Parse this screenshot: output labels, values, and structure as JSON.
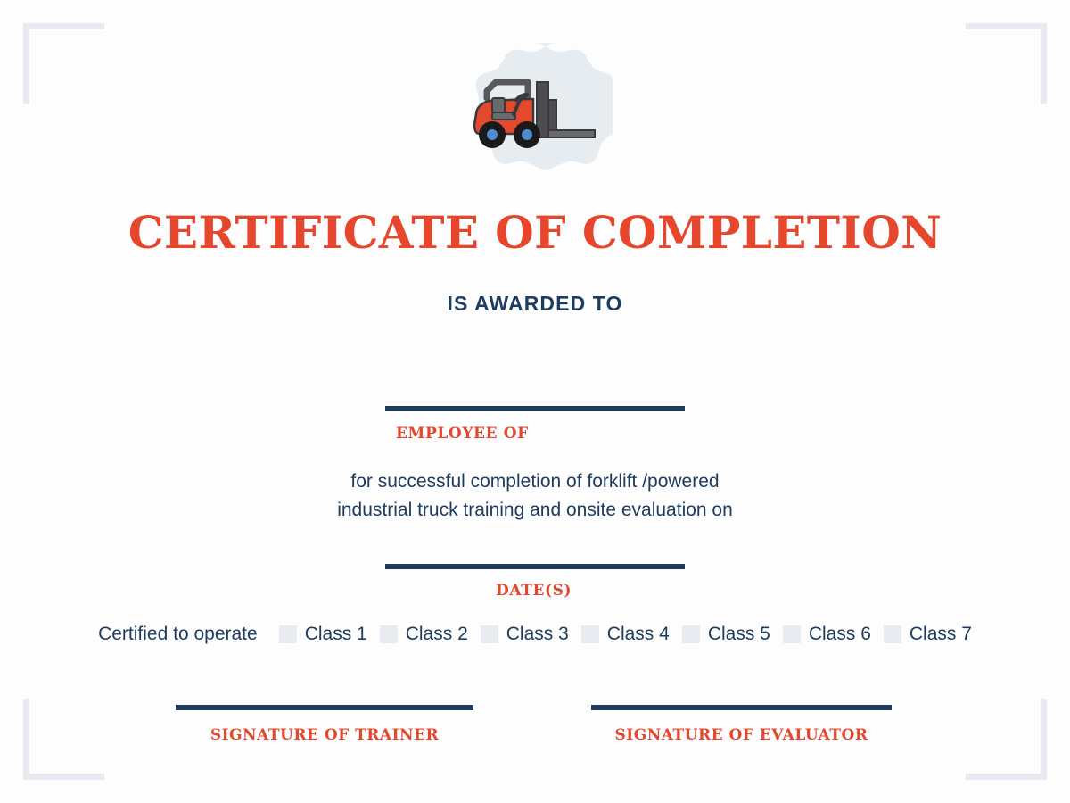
{
  "document": {
    "type": "certificate",
    "title": "CERTIFICATE OF COMPLETION",
    "subtitle": "IS AWARDED TO"
  },
  "colors": {
    "accent_red": "#e5462c",
    "navy": "#1d3c5e",
    "badge_bg": "#e7ecf1",
    "checkbox": "#e8ecf1",
    "corner_bracket": "#e7ebf1",
    "page_bg": "#fdfdfe"
  },
  "badge": {
    "icon": "forklift-icon",
    "shape": "scalloped-blob"
  },
  "fields": {
    "employee": {
      "caption": "EMPLOYEE OF",
      "value": ""
    },
    "dates": {
      "caption": "DATE(S)",
      "value": ""
    }
  },
  "body": {
    "line1": "for successful completion of forklift /powered",
    "line2": "industrial truck training and onsite evaluation on"
  },
  "classes": {
    "lead_label": "Certified to operate",
    "items": [
      {
        "label": "Class 1",
        "checked": false
      },
      {
        "label": "Class 2",
        "checked": false
      },
      {
        "label": "Class 3",
        "checked": false
      },
      {
        "label": "Class 4",
        "checked": false
      },
      {
        "label": "Class 5",
        "checked": false
      },
      {
        "label": "Class 6",
        "checked": false
      },
      {
        "label": "Class 7",
        "checked": false
      }
    ]
  },
  "signatures": {
    "trainer": {
      "label": "SIGNATURE OF TRAINER",
      "value": ""
    },
    "evaluator": {
      "label": "SIGNATURE OF EVALUATOR",
      "value": ""
    }
  }
}
